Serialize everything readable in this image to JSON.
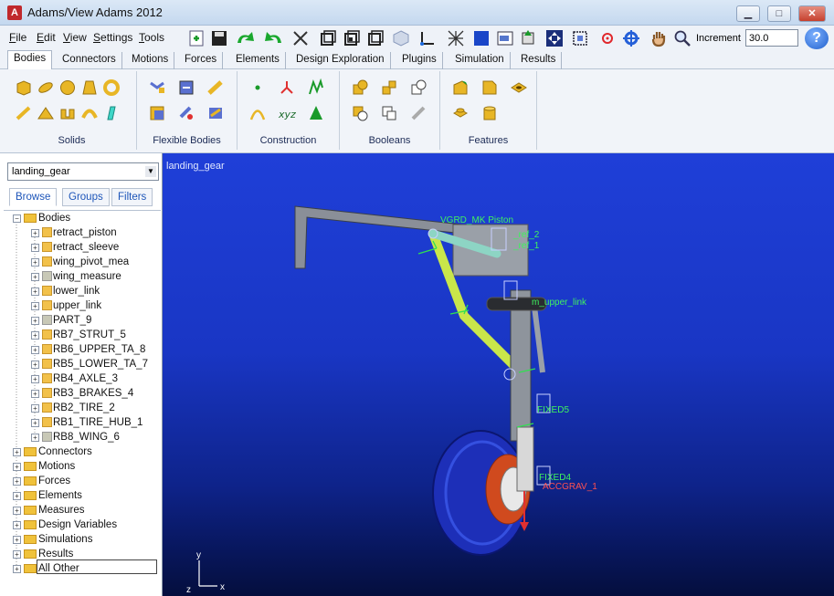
{
  "window": {
    "title": "Adams/View Adams 2012"
  },
  "menu": [
    "File",
    "Edit",
    "View",
    "Settings",
    "Tools"
  ],
  "toolbar": {
    "increment_label": "Increment",
    "increment_value": "30.0"
  },
  "ribbon_tabs": [
    "Bodies",
    "Connectors",
    "Motions",
    "Forces",
    "Elements",
    "Design Exploration",
    "Plugins",
    "Simulation",
    "Results"
  ],
  "ribbon_groups": [
    "Solids",
    "Flexible Bodies",
    "Construction",
    "Booleans",
    "Features"
  ],
  "model_select": {
    "value": "landing_gear"
  },
  "browser_tabs": [
    "Browse",
    "Groups",
    "Filters"
  ],
  "tree": {
    "bodies_label": "Bodies",
    "bodies": [
      "retract_piston",
      "retract_sleeve",
      "wing_pivot_mea",
      "wing_measure",
      "lower_link",
      "upper_link",
      "PART_9",
      "RB7_STRUT_5",
      "RB6_UPPER_TA_8",
      "RB5_LOWER_TA_7",
      "RB4_AXLE_3",
      "RB3_BRAKES_4",
      "RB2_TIRE_2",
      "RB1_TIRE_HUB_1",
      "RB8_WING_6"
    ],
    "folders": [
      "Connectors",
      "Motions",
      "Forces",
      "Elements",
      "Measures",
      "Design Variables",
      "Simulations",
      "Results",
      "All Other"
    ]
  },
  "viewport": {
    "model_name": "landing_gear",
    "labels": {
      "piston": "VGRD_MK Piston",
      "ref2": "_ref_2",
      "ref1": "_ref_1",
      "upper_link": "m_upper_link",
      "fixed5": "FIXED5",
      "fixed4": "FIXED4",
      "cg": "ACCGRAV_1"
    },
    "axes": {
      "y": "y",
      "x": "x",
      "z": "z"
    }
  },
  "colors": {
    "viewport_top": "#1f3fd8",
    "viewport_bottom": "#040e3d",
    "label_green": "#3ff25f",
    "brand_red": "#c0282c"
  }
}
